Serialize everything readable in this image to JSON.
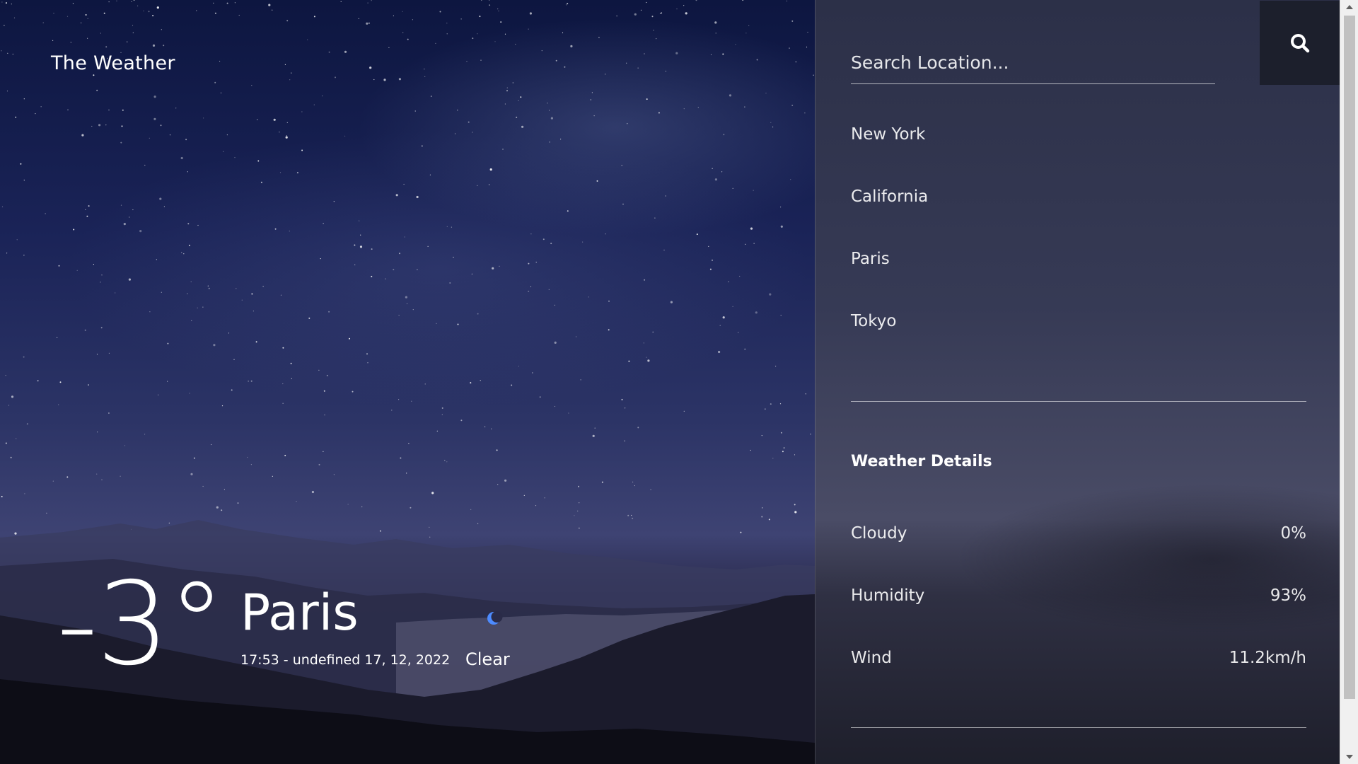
{
  "brand": {
    "title": "The Weather"
  },
  "current": {
    "temperature": "-3°",
    "city": "Paris",
    "datetime": "17:53 - undefined 17, 12, 2022",
    "condition": "Clear",
    "condition_icon": "moon-icon"
  },
  "search": {
    "placeholder": "Search Location...",
    "value": "",
    "button_icon": "search-icon"
  },
  "locations": [
    {
      "label": "New York"
    },
    {
      "label": "California"
    },
    {
      "label": "Paris"
    },
    {
      "label": "Tokyo"
    }
  ],
  "details": {
    "title": "Weather Details",
    "rows": [
      {
        "label": "Cloudy",
        "value": "0%"
      },
      {
        "label": "Humidity",
        "value": "93%"
      },
      {
        "label": "Wind",
        "value": "11.2km/h"
      }
    ]
  },
  "colors": {
    "panel_button": "#1c1f2c",
    "moon": "#4d8bff",
    "text": "#ffffff"
  }
}
